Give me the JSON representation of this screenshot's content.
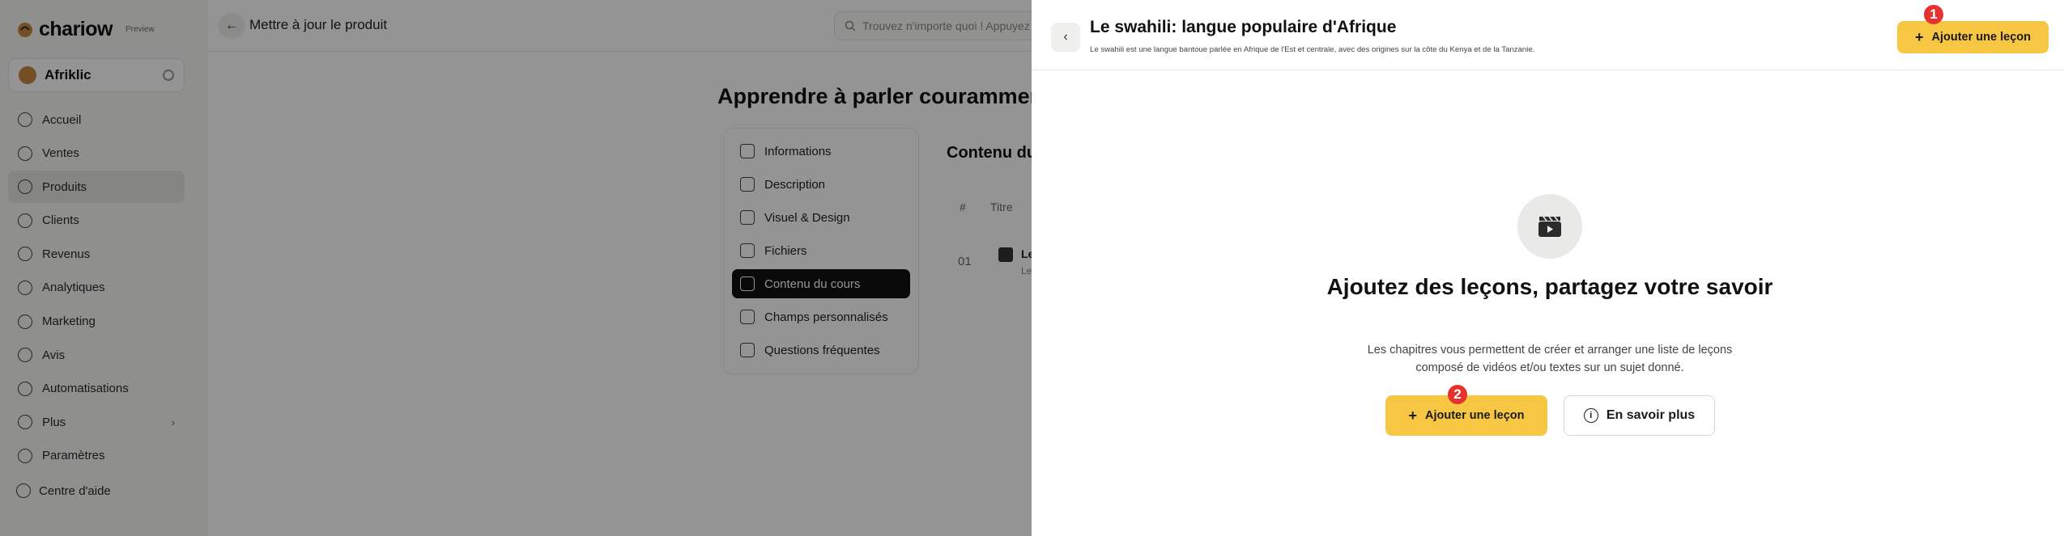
{
  "app": {
    "brand": "chariow",
    "preview_label": "Preview",
    "store_name": "Afriklic",
    "sidebar": {
      "items": [
        {
          "label": "Accueil",
          "icon": "home-icon"
        },
        {
          "label": "Ventes",
          "icon": "sales-icon"
        },
        {
          "label": "Produits",
          "icon": "products-icon",
          "active": true
        },
        {
          "label": "Clients",
          "icon": "users-icon"
        },
        {
          "label": "Revenus",
          "icon": "revenue-icon"
        },
        {
          "label": "Analytiques",
          "icon": "analytics-icon"
        },
        {
          "label": "Marketing",
          "icon": "marketing-icon"
        },
        {
          "label": "Avis",
          "icon": "reviews-icon"
        },
        {
          "label": "Automatisations",
          "icon": "automation-icon"
        },
        {
          "label": "Plus",
          "icon": "plus-circle-icon"
        },
        {
          "label": "Paramètres",
          "icon": "settings-icon"
        }
      ],
      "help_label": "Centre d'aide"
    },
    "topbar": {
      "title": "Mettre à jour le produit",
      "search_placeholder": "Trouvez n'importe quoi ! Appuyez s"
    },
    "course_title": "Apprendre à parler couramment u",
    "sub_nav": [
      {
        "label": "Informations"
      },
      {
        "label": "Description"
      },
      {
        "label": "Visuel & Design"
      },
      {
        "label": "Fichiers"
      },
      {
        "label": "Contenu du cours",
        "active": true
      },
      {
        "label": "Champs personnalisés"
      },
      {
        "label": "Questions fréquentes"
      }
    ],
    "content": {
      "title": "Contenu du",
      "col_hash": "#",
      "col_title": "Titre",
      "row_num": "01",
      "row_title": "Le",
      "row_sub": "Le"
    }
  },
  "drawer": {
    "title": "Le swahili: langue populaire d'Afrique",
    "description": "Le swahili est une langue bantoue parlée en Afrique de l'Est et centrale, avec des origines sur la côte du Kenya et de la Tanzanie.",
    "add_lesson_top": "Ajouter une leçon",
    "empty_title": "Ajoutez des leçons, partagez votre savoir",
    "empty_desc": "Les chapitres vous permettent de créer et arranger une liste de leçons composé de vidéos et/ou textes sur un sujet donné.",
    "add_lesson_main": "Ajouter une leçon",
    "learn_more": "En savoir plus",
    "badge_1": "1",
    "badge_2": "2"
  },
  "colors": {
    "accent": "#f7c744",
    "badge": "#e5312f",
    "active_tab": "#111111"
  }
}
